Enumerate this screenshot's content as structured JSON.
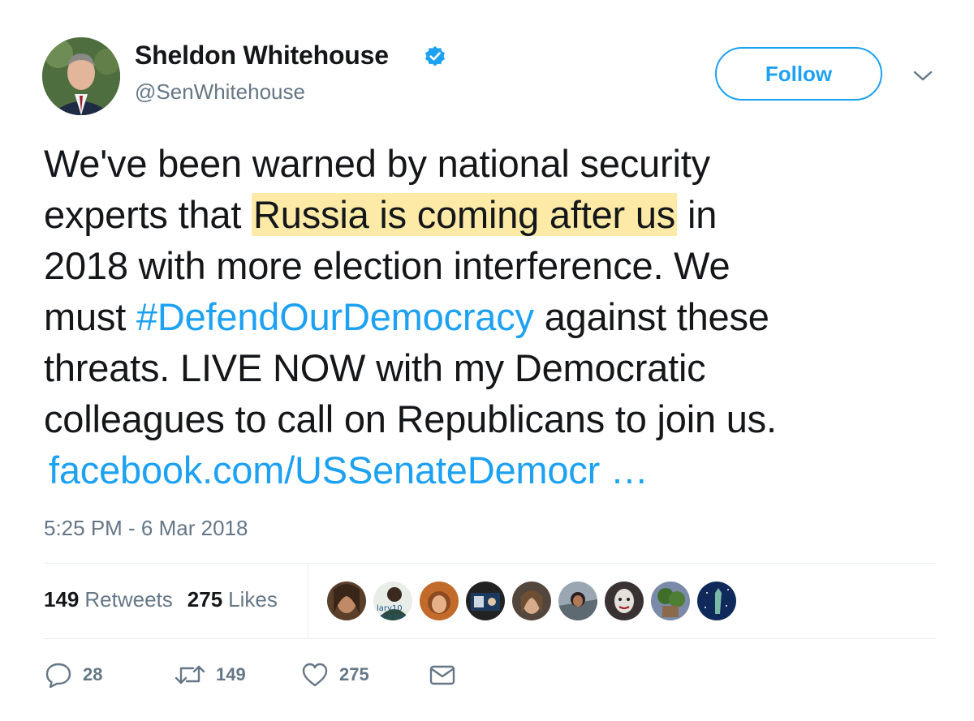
{
  "author": {
    "display_name": "Sheldon Whitehouse",
    "handle": "@SenWhitehouse",
    "verified": true
  },
  "header": {
    "follow_label": "Follow"
  },
  "tweet": {
    "text_lines": [
      "We've been warned by national security",
      "experts that ",
      "Russia is coming after us",
      " in",
      "2018 with more election interference. We",
      "must ",
      "#DefendOurDemocracy",
      " against these",
      "threats. LIVE NOW with my Democratic",
      "colleagues to call on Republicans to join us.",
      "facebook.com/USSenateDemocr …"
    ],
    "timestamp": "5:25 PM - 6 Mar 2018"
  },
  "stats": {
    "retweets_count": "149",
    "retweets_label": "Retweets",
    "likes_count": "275",
    "likes_label": "Likes"
  },
  "liker_avatars": [
    {
      "name": "liker-1",
      "color": "#7a5a3a"
    },
    {
      "name": "liker-2",
      "color": "#2f7a4a"
    },
    {
      "name": "liker-3",
      "color": "#b9662e"
    },
    {
      "name": "liker-4",
      "color": "#2a2a2a"
    },
    {
      "name": "liker-5",
      "color": "#3a4b5c"
    },
    {
      "name": "liker-6",
      "color": "#8a7a6a"
    },
    {
      "name": "liker-7",
      "color": "#4a3a3a"
    },
    {
      "name": "liker-8",
      "color": "#3a4a6a"
    },
    {
      "name": "liker-9",
      "color": "#5a7a3a"
    },
    {
      "name": "liker-10",
      "color": "#0f2a5a"
    }
  ],
  "actions": {
    "reply_count": "28",
    "retweet_count": "149",
    "like_count": "275"
  },
  "colors": {
    "accent": "#1da1f2",
    "highlight": "#fdeaa7",
    "secondary_text": "#657786"
  },
  "icons": {
    "verified": "verified-badge-icon",
    "more": "chevron-down-icon",
    "reply": "reply-icon",
    "retweet": "retweet-icon",
    "like": "heart-icon",
    "dm": "envelope-icon"
  }
}
